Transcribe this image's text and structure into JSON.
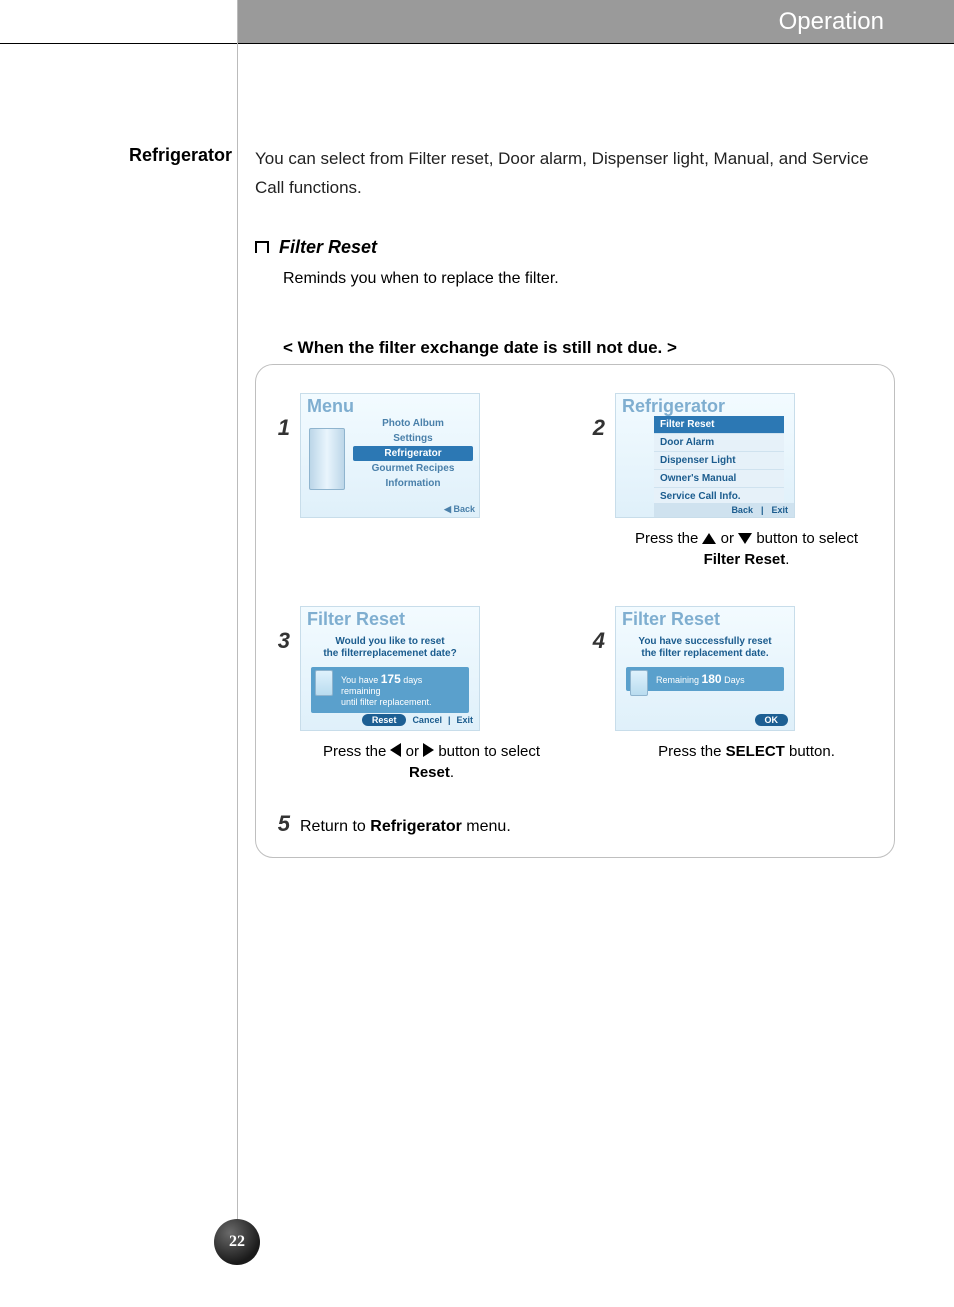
{
  "header": {
    "section_title": "Operation"
  },
  "sidebar": {
    "label": "Refrigerator"
  },
  "intro": "You can select from Filter reset, Door alarm, Dispenser light, Manual, and Service Call functions.",
  "filter_reset": {
    "heading": "Filter Reset",
    "description": "Reminds you when to replace the filter.",
    "scenario_title": "< When the filter exchange date is still not due. >"
  },
  "steps": {
    "s1": {
      "num": "1",
      "screen": {
        "title": "Menu",
        "items": [
          "Photo Album",
          "Settings",
          "Refrigerator",
          "Gourmet Recipes",
          "Information"
        ],
        "selected": "Refrigerator",
        "back": "◀ Back"
      }
    },
    "s2": {
      "num": "2",
      "screen": {
        "title": "Refrigerator",
        "items": [
          "Filter Reset",
          "Door Alarm",
          "Dispenser Light",
          "Owner's Manual",
          "Service Call Info."
        ],
        "selected": "Filter Reset",
        "buttons": [
          "Back",
          "Exit"
        ]
      },
      "caption_pre": "Press the ",
      "caption_mid": " or ",
      "caption_post": " button to select ",
      "caption_bold": "Filter Reset",
      "caption_end": "."
    },
    "s3": {
      "num": "3",
      "screen": {
        "title": "Filter Reset",
        "question_l1": "Would you like to reset",
        "question_l2": "the filterreplacemenet date?",
        "box_pre": "You have ",
        "box_days": "175",
        "box_mid": " days remaining",
        "box_l2": "until filter replacement.",
        "buttons": {
          "primary": "Reset",
          "others": [
            "Cancel",
            "Exit"
          ]
        }
      },
      "caption_pre": "Press the ",
      "caption_mid": " or ",
      "caption_post": " button to select ",
      "caption_bold": "Reset",
      "caption_end": "."
    },
    "s4": {
      "num": "4",
      "screen": {
        "title": "Filter Reset",
        "msg_l1": "You have successfully reset",
        "msg_l2": "the filter replacement date.",
        "box_pre": "Remaining ",
        "box_days": "180",
        "box_post": " Days",
        "ok": "OK"
      },
      "caption_pre": "Press the ",
      "caption_bold": "SELECT",
      "caption_end": " button."
    },
    "s5": {
      "num": "5",
      "text_pre": "Return to ",
      "text_bold": "Refrigerator",
      "text_post": " menu."
    }
  },
  "page_number": "22"
}
